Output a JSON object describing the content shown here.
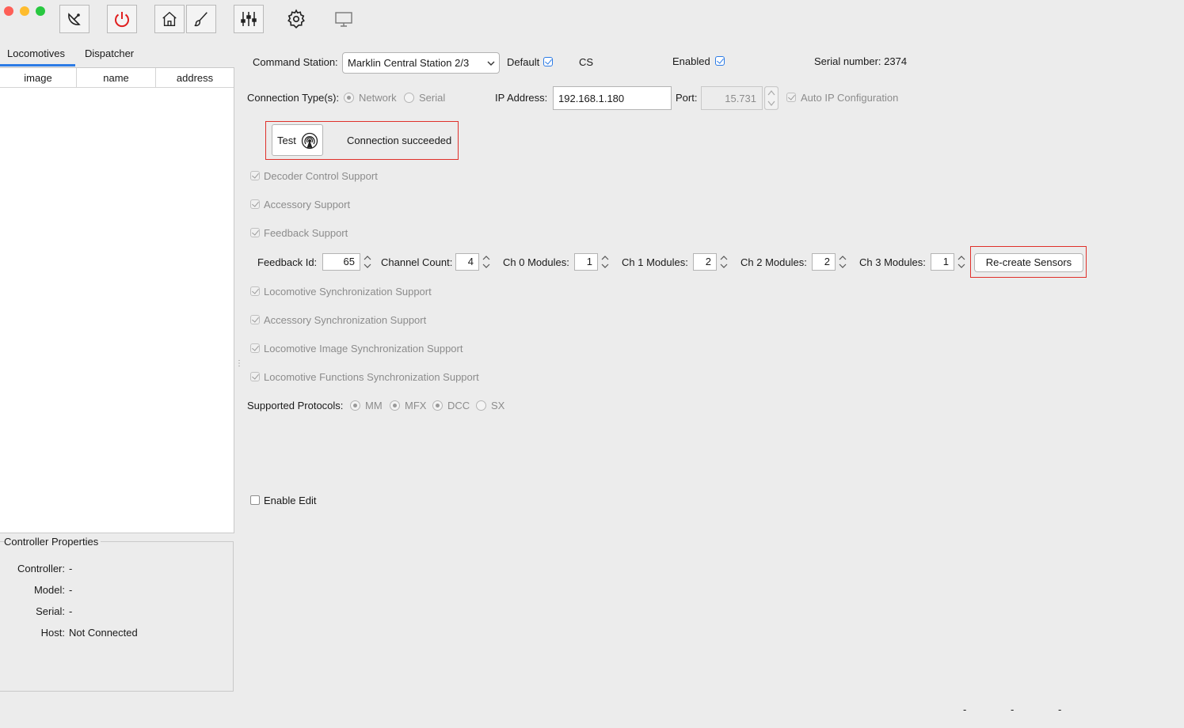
{
  "window": {
    "close_color": "#fe5f57",
    "minimize_color": "#febc2e",
    "zoom_color": "#28c840"
  },
  "toolbar": {
    "icons": [
      "connect-icon",
      "power-icon",
      "home-icon",
      "brush-icon",
      "sliders-icon",
      "gear-icon",
      "monitor-icon"
    ],
    "power_color": "#e02020"
  },
  "tabs": [
    "Locomotives",
    "Dispatcher"
  ],
  "loco_table": {
    "columns": [
      "image",
      "name",
      "address"
    ]
  },
  "controller_properties": {
    "title": "Controller Properties",
    "rows": [
      {
        "label": "Controller:",
        "value": "-"
      },
      {
        "label": "Model:",
        "value": "-"
      },
      {
        "label": "Serial:",
        "value": "-"
      },
      {
        "label": "Host:",
        "value": "Not Connected"
      }
    ]
  },
  "command_station": {
    "label": "Command Station:",
    "selected": "Marklin Central Station 2/3",
    "default_label": "Default",
    "default_checked": true,
    "short_name": "CS",
    "enabled_label": "Enabled",
    "enabled_checked": true,
    "serial_label": "Serial number: 2374"
  },
  "connection": {
    "types_label": "Connection Type(s):",
    "network_label": "Network",
    "serial_label": "Serial",
    "ip_label": "IP Address:",
    "ip_value": "192.168.1.180",
    "port_label": "Port:",
    "port_value": "15.731",
    "auto_ip_label": "Auto IP Configuration",
    "test_label": "Test",
    "status": "Connection succeeded"
  },
  "supports": {
    "decoder": "Decoder Control Support",
    "accessory": "Accessory Support",
    "feedback": "Feedback Support",
    "loco_sync": "Locomotive Synchronization Support",
    "accessory_sync": "Accessory Synchronization Support",
    "loco_image_sync": "Locomotive Image Synchronization Support",
    "loco_functions_sync": "Locomotive Functions Synchronization Support"
  },
  "feedback": {
    "id_label": "Feedback Id:",
    "id_value": "65",
    "channel_label": "Channel Count:",
    "channel_value": "4",
    "ch0_label": "Ch 0 Modules:",
    "ch0_value": "1",
    "ch1_label": "Ch 1 Modules:",
    "ch1_value": "2",
    "ch2_label": "Ch 2 Modules:",
    "ch2_value": "2",
    "ch3_label": "Ch 3 Modules:",
    "ch3_value": "1",
    "recreate_label": "Re-create Sensors"
  },
  "protocols": {
    "label": "Supported Protocols:",
    "items": [
      {
        "name": "MM",
        "selected": true
      },
      {
        "name": "MFX",
        "selected": true
      },
      {
        "name": "DCC",
        "selected": true
      },
      {
        "name": "SX",
        "selected": false
      }
    ]
  },
  "enable_edit_label": "Enable Edit",
  "status_bar": [
    "-",
    "-",
    "-"
  ]
}
